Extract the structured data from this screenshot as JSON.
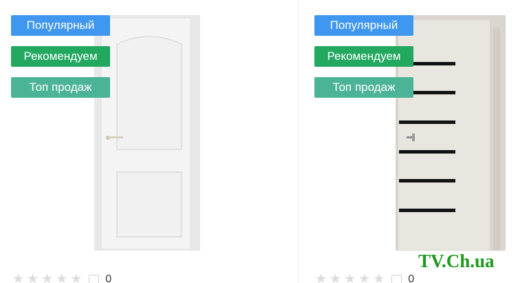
{
  "products": [
    {
      "badges": {
        "popular": "Популярный",
        "recommend": "Рекомендуем",
        "top": "Топ продаж"
      },
      "compare_count": "0"
    },
    {
      "badges": {
        "popular": "Популярный",
        "recommend": "Рекомендуем",
        "top": "Топ продаж"
      },
      "compare_count": "0"
    }
  ],
  "watermark": "TV.Ch.ua",
  "colors": {
    "badge_popular": "#3f97ef",
    "badge_recommend": "#22a85f",
    "badge_top": "#4bb396",
    "star_empty": "#dcdcdc",
    "watermark": "#1d9a1d"
  }
}
